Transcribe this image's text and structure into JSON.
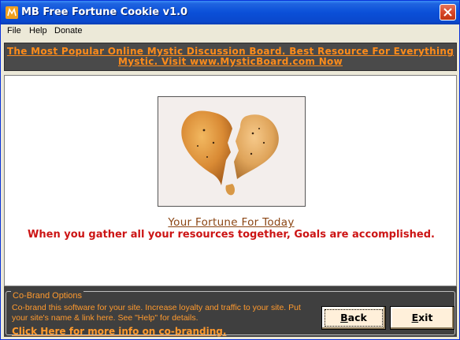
{
  "window": {
    "title": "MB Free Fortune Cookie v1.0"
  },
  "menu": {
    "items": [
      {
        "label": "File"
      },
      {
        "label": "Help"
      },
      {
        "label": "Donate"
      }
    ]
  },
  "banner": {
    "line1": "The Most Popular Online Mystic Discussion Board. Best Resource For Everything",
    "line2": "Mystic. Visit www.MysticBoard.com Now"
  },
  "fortune": {
    "title": "Your Fortune For Today",
    "text": "When you gather all your resources together, Goals are accomplished."
  },
  "cobrand": {
    "legend": "Co-Brand Options",
    "description": "Co-brand this software for your site.  Increase loyalty and traffic to your site. Put your site's name &  link here. See \"Help\" for details.",
    "link": "Click Here for more info on co-branding."
  },
  "buttons": {
    "back_first": "B",
    "back_rest": "ack",
    "exit_first": "E",
    "exit_rest": "xit"
  },
  "colors": {
    "accent_orange": "#ff8c1a",
    "fortune_red": "#cc1414",
    "title_brown": "#8b4513",
    "panel_dark": "#3f3f3f"
  },
  "icons": {
    "app": "mb-app-icon",
    "close": "close-icon",
    "cookie": "broken-fortune-cookie-image"
  }
}
